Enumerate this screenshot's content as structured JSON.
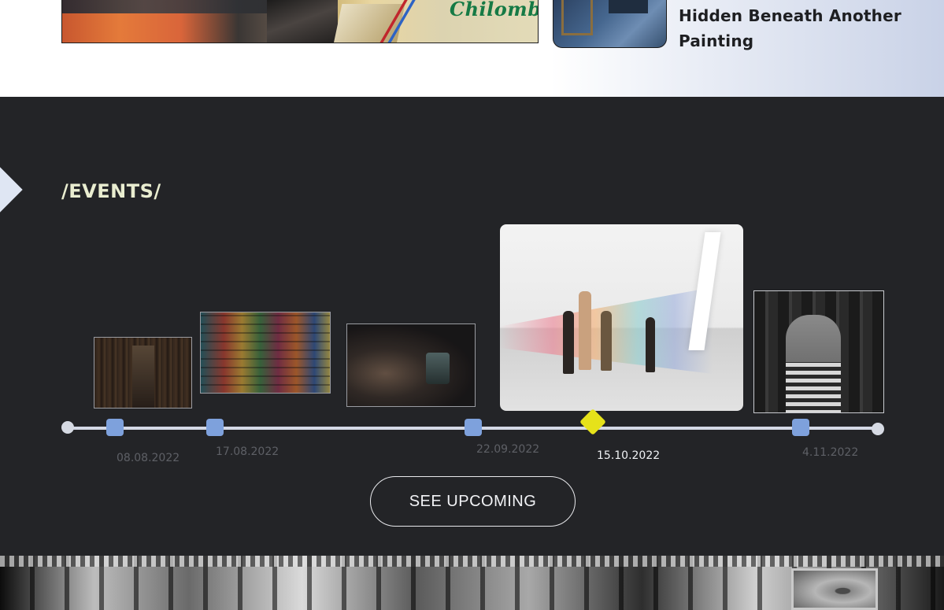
{
  "featured": {
    "poster_word": "Chilombia",
    "article_title": "Hidden Beneath Another Painting"
  },
  "events": {
    "title": "/EVENTS/",
    "items": [
      {
        "date": "08.08.2022",
        "image": "library-shelves-photo",
        "active": false
      },
      {
        "date": "17.08.2022",
        "image": "colorful-books-photo",
        "active": false
      },
      {
        "date": "22.09.2022",
        "image": "party-drinks-photo",
        "active": false
      },
      {
        "date": "15.10.2022",
        "image": "rainbow-gallery-photo",
        "active": true
      },
      {
        "date": "4.11.2022",
        "image": "woman-portrait-photo",
        "active": false
      }
    ],
    "cta_label": "SEE UPCOMING"
  },
  "colors": {
    "section_bg": "#232427",
    "marker": "#7ea1dc",
    "active_marker": "#e6e21a",
    "title": "#e9edd0"
  }
}
